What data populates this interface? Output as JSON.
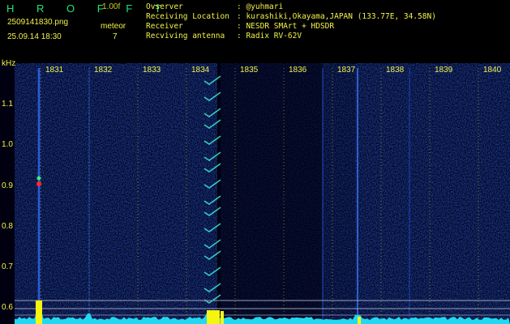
{
  "header": {
    "app_title": "H R O F F T",
    "version": "1.00f",
    "filename": "2509141830.png",
    "meteor_label": "meteor",
    "datetime": "25.09.14 18:30",
    "meteor_count": "7"
  },
  "station": [
    {
      "key": "Ovserver",
      "value": ": @yuhmari"
    },
    {
      "key": "Receiving Location",
      "value": ": kurashiki,Okayama,JAPAN (133.77E, 34.58N)"
    },
    {
      "key": "Receiver",
      "value": ": NESDR SMArt + HDSDR"
    },
    {
      "key": "Recviving antenna",
      "value": ": Radix RV-62V"
    }
  ],
  "axes": {
    "y_unit": "kHz",
    "y_ticks": [
      "1.1",
      "1.0",
      "0.9",
      "0.8",
      "0.7",
      "0.6"
    ],
    "x_ticks": [
      "1831",
      "1832",
      "1833",
      "1834",
      "1835",
      "1836",
      "1837",
      "1838",
      "1839",
      "1840"
    ]
  },
  "colors": {
    "background": "#000000",
    "label": "#f2f24a",
    "title": "#22e07a",
    "noise": "#0d1f8c",
    "meteor": "#38e0c8",
    "baseline": "#22d8f0",
    "peak": "#f5f510"
  }
}
